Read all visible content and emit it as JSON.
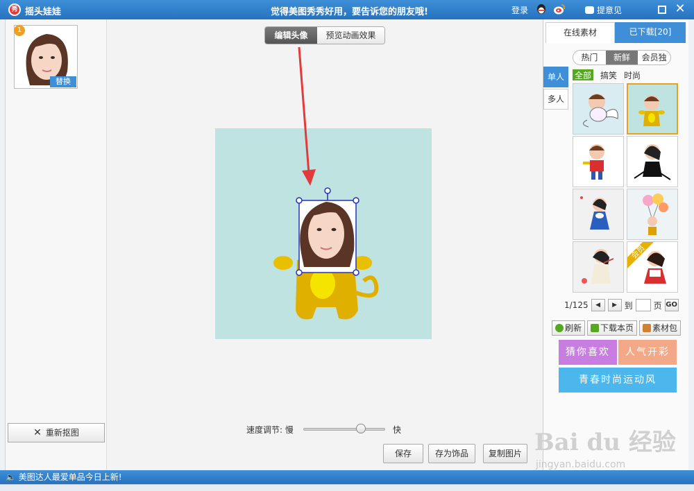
{
  "titlebar": {
    "app_title": "摇头娃娃",
    "logo_text": "秀",
    "slogan": "觉得美图秀秀好用，要告诉您的朋友哦!",
    "login": "登录",
    "feedback": "提意见"
  },
  "left": {
    "badge": "1",
    "replace": "替换",
    "recut": "重新抠图"
  },
  "center": {
    "tabs": [
      "编辑头像",
      "预览动画效果"
    ],
    "speed_label": "速度调节: 慢",
    "fast_label": "快",
    "speed_value": 0.7,
    "buttons": {
      "save": "保存",
      "save_as": "存为饰品",
      "copy": "复制图片"
    }
  },
  "right": {
    "tabs": [
      "在线素材",
      "已下载[20]"
    ],
    "filters": [
      "热门",
      "新鲜",
      "会员独享"
    ],
    "side_tabs": [
      "单人",
      "多人"
    ],
    "subfilters": [
      "全部",
      "搞笑",
      "时尚"
    ],
    "member_tag": "会员",
    "pager": {
      "page": "1/125",
      "to": "到",
      "page_unit": "页",
      "go": "GO"
    },
    "actions": {
      "refresh": "刷新",
      "download_page": "下载本页",
      "package": "素材包"
    },
    "banners": [
      "猜你喜欢",
      "人气开彩",
      "青春时尚运动风"
    ]
  },
  "status": {
    "text": "美图达人最爱单品今日上新!"
  },
  "watermark": {
    "logo": "Bai du 经验",
    "url": "jingyan.baidu.com"
  },
  "colors": {
    "accent": "#3e8fd8",
    "canvas_bg": "#bfe3e1",
    "arrow": "#e23b3b",
    "character": "#e0b000"
  }
}
